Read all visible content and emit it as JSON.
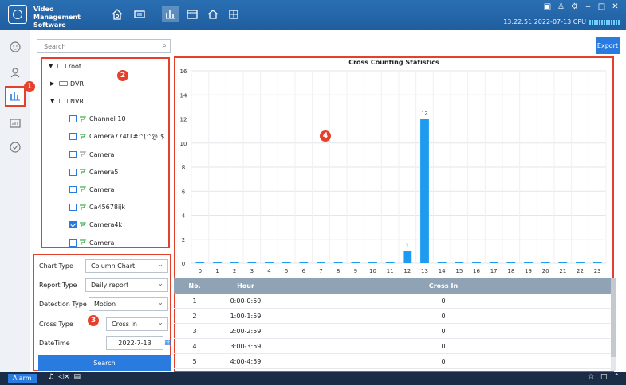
{
  "app": {
    "title": "Video Management\nSoftware",
    "statusline": "13:22:51 2022-07-13 CPU"
  },
  "titlebar_tabs": [
    {
      "icon": "home-icon"
    },
    {
      "icon": "layout-icon"
    },
    {
      "icon": "statistics-icon",
      "active": true
    },
    {
      "icon": "window-icon"
    },
    {
      "icon": "home-settings-icon"
    },
    {
      "icon": "grid-icon"
    }
  ],
  "rail": [
    {
      "icon": "face-icon"
    },
    {
      "icon": "gear-person-icon"
    },
    {
      "icon": "cross-counting-icon",
      "active": true
    },
    {
      "icon": "people-stats-icon"
    },
    {
      "icon": "clock-check-icon"
    }
  ],
  "markers": {
    "m1": "1",
    "m2": "2",
    "m3": "3",
    "m4": "4"
  },
  "search": {
    "placeholder": "Search"
  },
  "tree": [
    {
      "label": "root",
      "level": 0,
      "type": "folder",
      "expanded": true
    },
    {
      "label": "DVR",
      "level": 1,
      "type": "folder",
      "expanded": false
    },
    {
      "label": "NVR",
      "level": 1,
      "type": "folder",
      "expanded": true
    },
    {
      "label": "Channel 10",
      "level": 2,
      "type": "camera",
      "checked": false,
      "online": true
    },
    {
      "label": "Camera774tT#^(^@!$...",
      "level": 2,
      "type": "camera",
      "checked": false,
      "online": true
    },
    {
      "label": "Camera",
      "level": 2,
      "type": "camera",
      "checked": false,
      "online": false
    },
    {
      "label": "Camera5",
      "level": 2,
      "type": "camera",
      "checked": false,
      "online": true
    },
    {
      "label": "Camera",
      "level": 2,
      "type": "camera",
      "checked": false,
      "online": true
    },
    {
      "label": "Ca45678ijk",
      "level": 2,
      "type": "camera",
      "checked": false,
      "online": true
    },
    {
      "label": "Camera4k",
      "level": 2,
      "type": "camera",
      "checked": true,
      "online": true
    },
    {
      "label": "Camera",
      "level": 2,
      "type": "camera",
      "checked": false,
      "online": true
    }
  ],
  "filters": {
    "chart_type": {
      "label": "Chart Type",
      "value": "Column Chart"
    },
    "report_type": {
      "label": "Report Type",
      "value": "Daily report"
    },
    "detection_type": {
      "label": "Detection Type",
      "value": "Motion"
    },
    "cross_type": {
      "label": "Cross Type",
      "value": "Cross In"
    },
    "datetime": {
      "label": "DateTime",
      "value": "2022-7-13"
    }
  },
  "buttons": {
    "search": "Search",
    "export": "Export"
  },
  "table": {
    "headers": [
      "No.",
      "Hour",
      "Cross In"
    ],
    "rows": [
      [
        "1",
        "0:00-0:59",
        "0"
      ],
      [
        "2",
        "1:00-1:59",
        "0"
      ],
      [
        "3",
        "2:00-2:59",
        "0"
      ],
      [
        "4",
        "3:00-3:59",
        "0"
      ],
      [
        "5",
        "4:00-4:59",
        "0"
      ]
    ]
  },
  "bottombar": {
    "alarm": "Alarm"
  },
  "colors": {
    "accent": "#2a7be0",
    "bar": "#1e9bf0",
    "highlight": "#e4412c"
  },
  "chart_data": {
    "type": "bar",
    "title": "Cross Counting Statistics",
    "categories": [
      "0",
      "1",
      "2",
      "3",
      "4",
      "5",
      "6",
      "7",
      "8",
      "9",
      "10",
      "11",
      "12",
      "13",
      "14",
      "15",
      "16",
      "17",
      "18",
      "19",
      "20",
      "21",
      "22",
      "23"
    ],
    "values": [
      0,
      0,
      0,
      0,
      0,
      0,
      0,
      0,
      0,
      0,
      0,
      0,
      1,
      12,
      0,
      0,
      0,
      0,
      0,
      0,
      0,
      0,
      0,
      0
    ],
    "ylim": [
      0,
      16
    ],
    "yticks": [
      0,
      2,
      4,
      6,
      8,
      10,
      12,
      14,
      16
    ],
    "data_labels": {
      "12": "1",
      "13": "12"
    },
    "grid": true
  }
}
